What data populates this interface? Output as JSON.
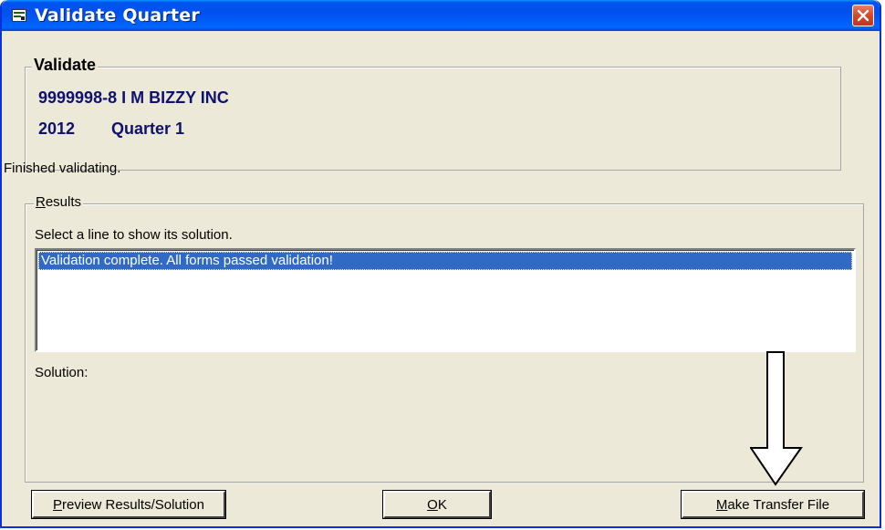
{
  "window": {
    "title": "Validate Quarter"
  },
  "validate_group": {
    "legend": "Validate",
    "employer": "9999998-8 I M BIZZY INC",
    "year": "2012",
    "quarter": "Quarter 1"
  },
  "status_text": "Finished validating.",
  "results_group": {
    "legend_underlined": "R",
    "legend_rest": "esults",
    "instruction": "Select a line to show its solution.",
    "items": [
      "Validation complete.  All forms passed validation!"
    ],
    "solution_label": "Solution:"
  },
  "buttons": {
    "preview_underlined": "P",
    "preview_rest": "review Results/Solution",
    "ok_underlined": "O",
    "ok_rest": "K",
    "transfer_pre": "",
    "transfer_underlined": "M",
    "transfer_rest": "ake Transfer File"
  },
  "colors": {
    "titlebar": "#0053ee",
    "selection": "#316ac5",
    "header_text": "#10106e",
    "face": "#ece9d8"
  },
  "annotation": {
    "icon": "down-arrow-icon"
  }
}
